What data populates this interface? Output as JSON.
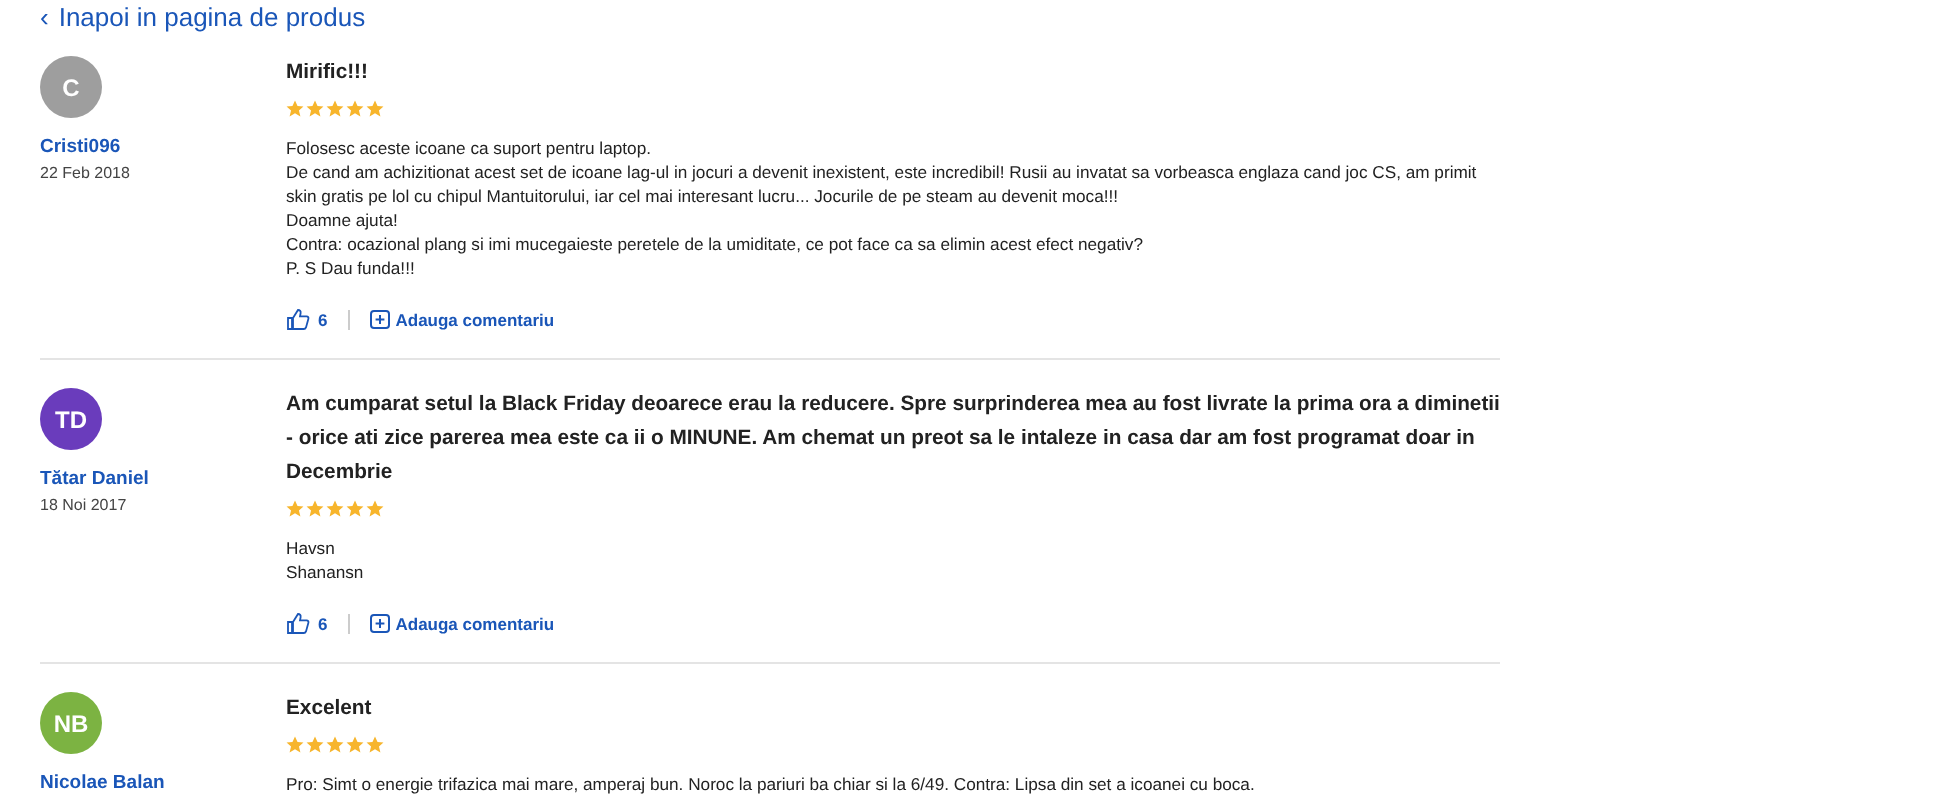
{
  "back_link": {
    "icon": "‹",
    "label": "Inapoi in pagina de produs"
  },
  "reviews": [
    {
      "avatar": {
        "initials": "C",
        "color": "#9e9e9e"
      },
      "author": "Cristi096",
      "date": "22 Feb 2018",
      "title": "Mirific!!!",
      "stars": 5,
      "body": [
        "Folosesc aceste icoane ca suport pentru laptop.",
        "De cand am achizitionat acest set de icoane lag-ul in jocuri a devenit inexistent, este incredibil! Rusii au invatat sa vorbeasca englaza cand joc CS, am primit skin gratis pe lol cu chipul Mantuitorului, iar cel mai interesant lucru... Jocurile de pe steam au devenit moca!!!",
        "Doamne ajuta!",
        "Contra: ocazional plang si imi mucegaieste peretele de la umiditate, ce pot face ca sa elimin acest efect negativ?",
        "P. S Dau funda!!!"
      ],
      "likes": "6",
      "comment_label": "Adauga comentariu"
    },
    {
      "avatar": {
        "initials": "TD",
        "color": "#6a3cbc"
      },
      "author": "Tătar Daniel",
      "date": "18 Noi 2017",
      "title": "Am cumparat setul la Black Friday deoarece erau la reducere. Spre surprinderea mea au fost livrate la prima ora a diminetii - orice ati zice parerea mea este ca ii o MINUNE. Am chemat un preot sa le intaleze in casa dar am fost programat doar in Decembrie",
      "stars": 5,
      "body": [
        "Havsn",
        "Shanansn"
      ],
      "likes": "6",
      "comment_label": "Adauga comentariu"
    },
    {
      "avatar": {
        "initials": "NB",
        "color": "#7cb342"
      },
      "author": "Nicolae Balan",
      "title": "Excelent",
      "stars": 5,
      "body": [
        "Pro: Simt o energie trifazica mai mare, amperaj bun. Noroc la pariuri ba chiar si la 6/49. Contra: Lipsa din set a icoanei cu boca."
      ]
    }
  ]
}
